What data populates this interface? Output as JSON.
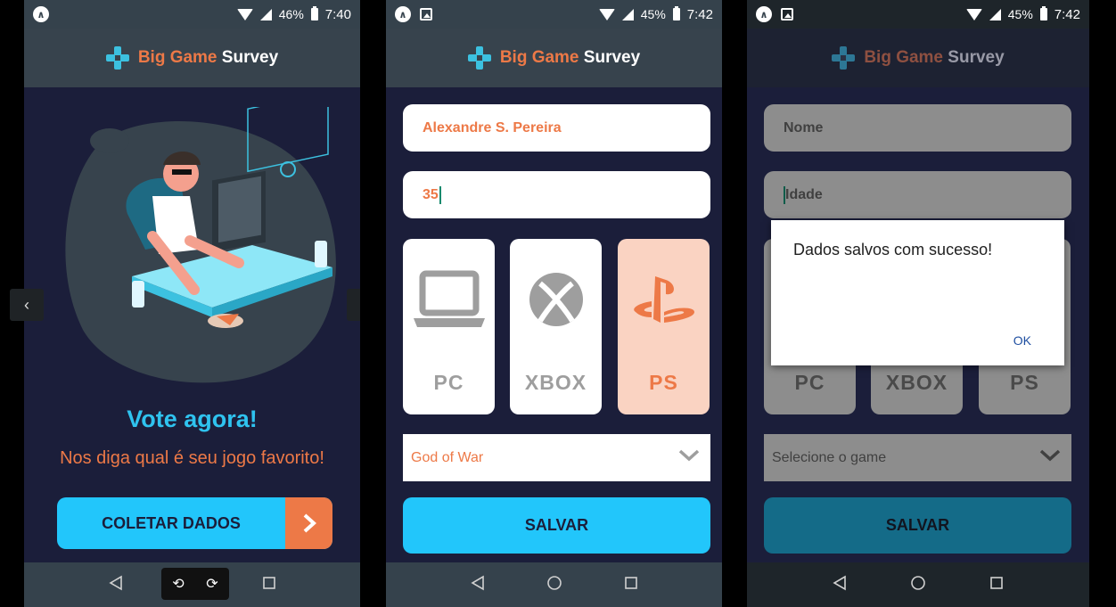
{
  "status_bars": [
    {
      "battery": "46%",
      "time": "7:40"
    },
    {
      "battery": "45%",
      "time": "7:42"
    },
    {
      "battery": "45%",
      "time": "7:42"
    }
  ],
  "header": {
    "brand_part1": "Big Game",
    "brand_part2": "Survey"
  },
  "home": {
    "title": "Vote agora!",
    "subtitle": "Nos diga qual é seu jogo favorito!",
    "collect_button": "COLETAR DADOS",
    "left_tab_glyph": "‹"
  },
  "form": {
    "name_value": "Alexandre S. Pereira",
    "age_value": "35",
    "platforms": [
      "PC",
      "XBOX",
      "PS"
    ],
    "selected_platform": "PS",
    "game_value": "God of War",
    "save_button": "SALVAR"
  },
  "form_empty": {
    "name_placeholder": "Nome",
    "age_placeholder": "Idade",
    "game_placeholder": "Selecione o game",
    "save_button": "SALVAR"
  },
  "dialog": {
    "message": "Dados salvos com sucesso!",
    "ok": "OK"
  },
  "colors": {
    "accent": "#22c6fb",
    "orange": "#ed7947",
    "background": "#1b1e3a"
  },
  "icons": [
    "app-icon",
    "image-icon",
    "wifi-icon",
    "signal-icon",
    "battery-icon",
    "back-icon",
    "home-icon",
    "recents-icon",
    "rotate-left-icon",
    "rotate-right-icon",
    "gamepad-logo-icon",
    "laptop-icon",
    "xbox-icon",
    "playstation-icon",
    "chevron-down-icon",
    "chevron-right-icon"
  ]
}
